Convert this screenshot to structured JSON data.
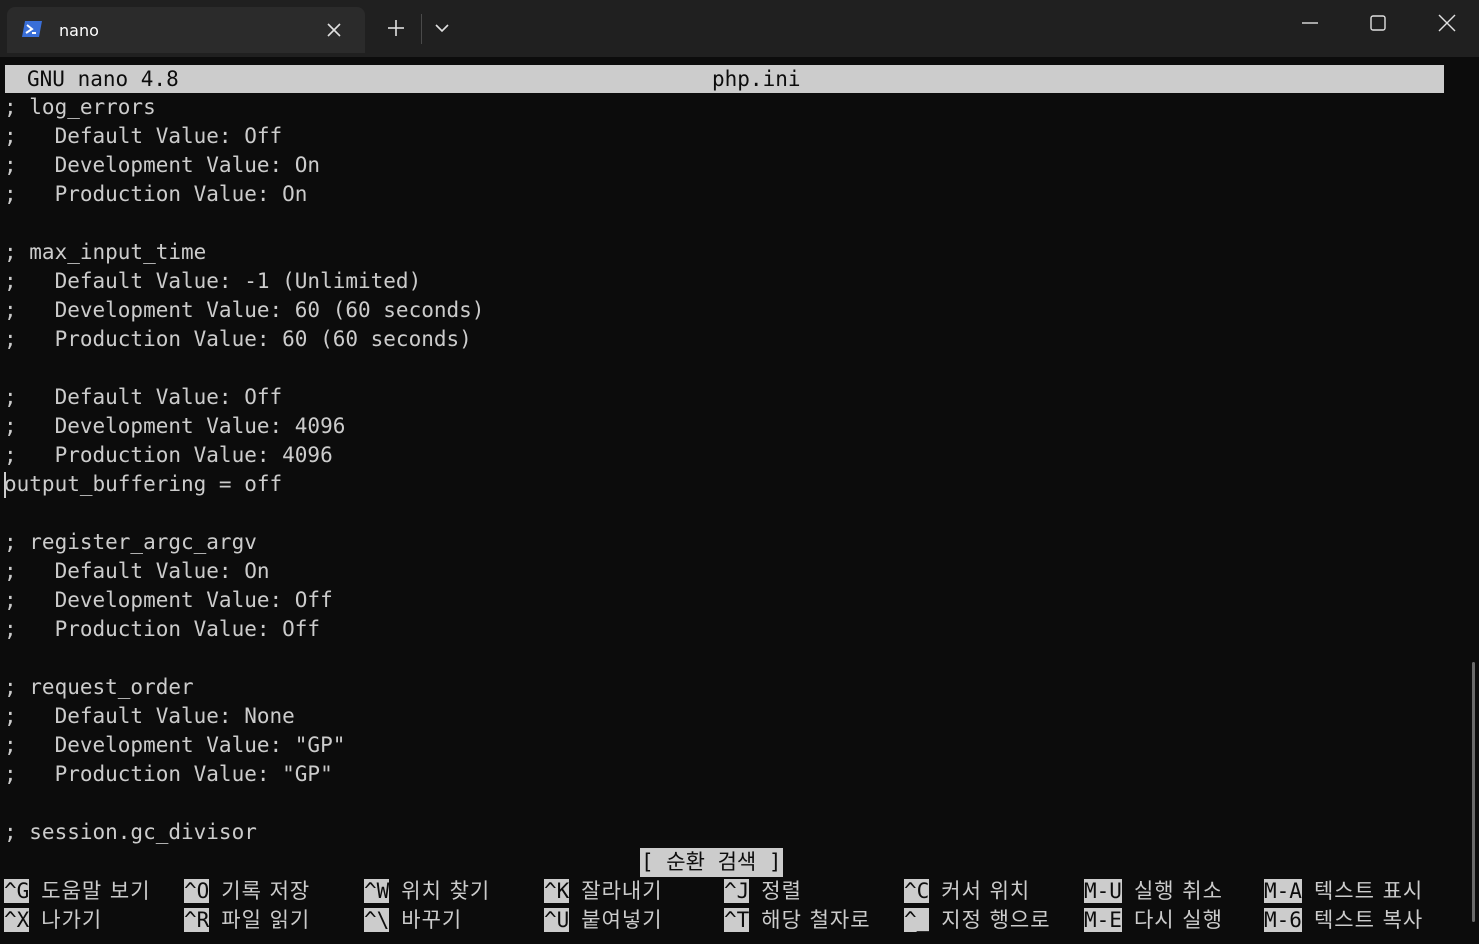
{
  "window": {
    "tab_title": "nano",
    "tab_icon": "powershell-icon",
    "accent": "#3a6fd8"
  },
  "nano": {
    "version": "GNU nano 4.8",
    "filename": "php.ini",
    "status_message": "[ 순환 검색 ]",
    "lines": [
      "; log_errors",
      ";   Default Value: Off",
      ";   Development Value: On",
      ";   Production Value: On",
      "",
      "; max_input_time",
      ";   Default Value: -1 (Unlimited)",
      ";   Development Value: 60 (60 seconds)",
      ";   Production Value: 60 (60 seconds)",
      "",
      ";   Default Value: Off",
      ";   Development Value: 4096",
      ";   Production Value: 4096",
      "output_buffering = off",
      "",
      "; register_argc_argv",
      ";   Default Value: On",
      ";   Development Value: Off",
      ";   Production Value: Off",
      "",
      "; request_order",
      ";   Default Value: None",
      ";   Development Value: \"GP\"",
      ";   Production Value: \"GP\"",
      "",
      "; session.gc_divisor"
    ],
    "shortcuts_row1": [
      {
        "key": "^G",
        "label": "도움말 보기"
      },
      {
        "key": "^O",
        "label": "기록 저장"
      },
      {
        "key": "^W",
        "label": "위치 찾기"
      },
      {
        "key": "^K",
        "label": "잘라내기"
      },
      {
        "key": "^J",
        "label": "정렬"
      },
      {
        "key": "^C",
        "label": "커서 위치"
      },
      {
        "key": "M-U",
        "label": "실행 취소"
      },
      {
        "key": "M-A",
        "label": "텍스트 표시"
      }
    ],
    "shortcuts_row2": [
      {
        "key": "^X",
        "label": "나가기"
      },
      {
        "key": "^R",
        "label": "파일 읽기"
      },
      {
        "key": "^\\",
        "label": "바꾸기"
      },
      {
        "key": "^U",
        "label": "붙여넣기"
      },
      {
        "key": "^T",
        "label": "해당 철자로"
      },
      {
        "key": "^_",
        "label": "지정 행으로"
      },
      {
        "key": "M-E",
        "label": "다시 실행"
      },
      {
        "key": "M-6",
        "label": "텍스트 복사"
      }
    ]
  }
}
